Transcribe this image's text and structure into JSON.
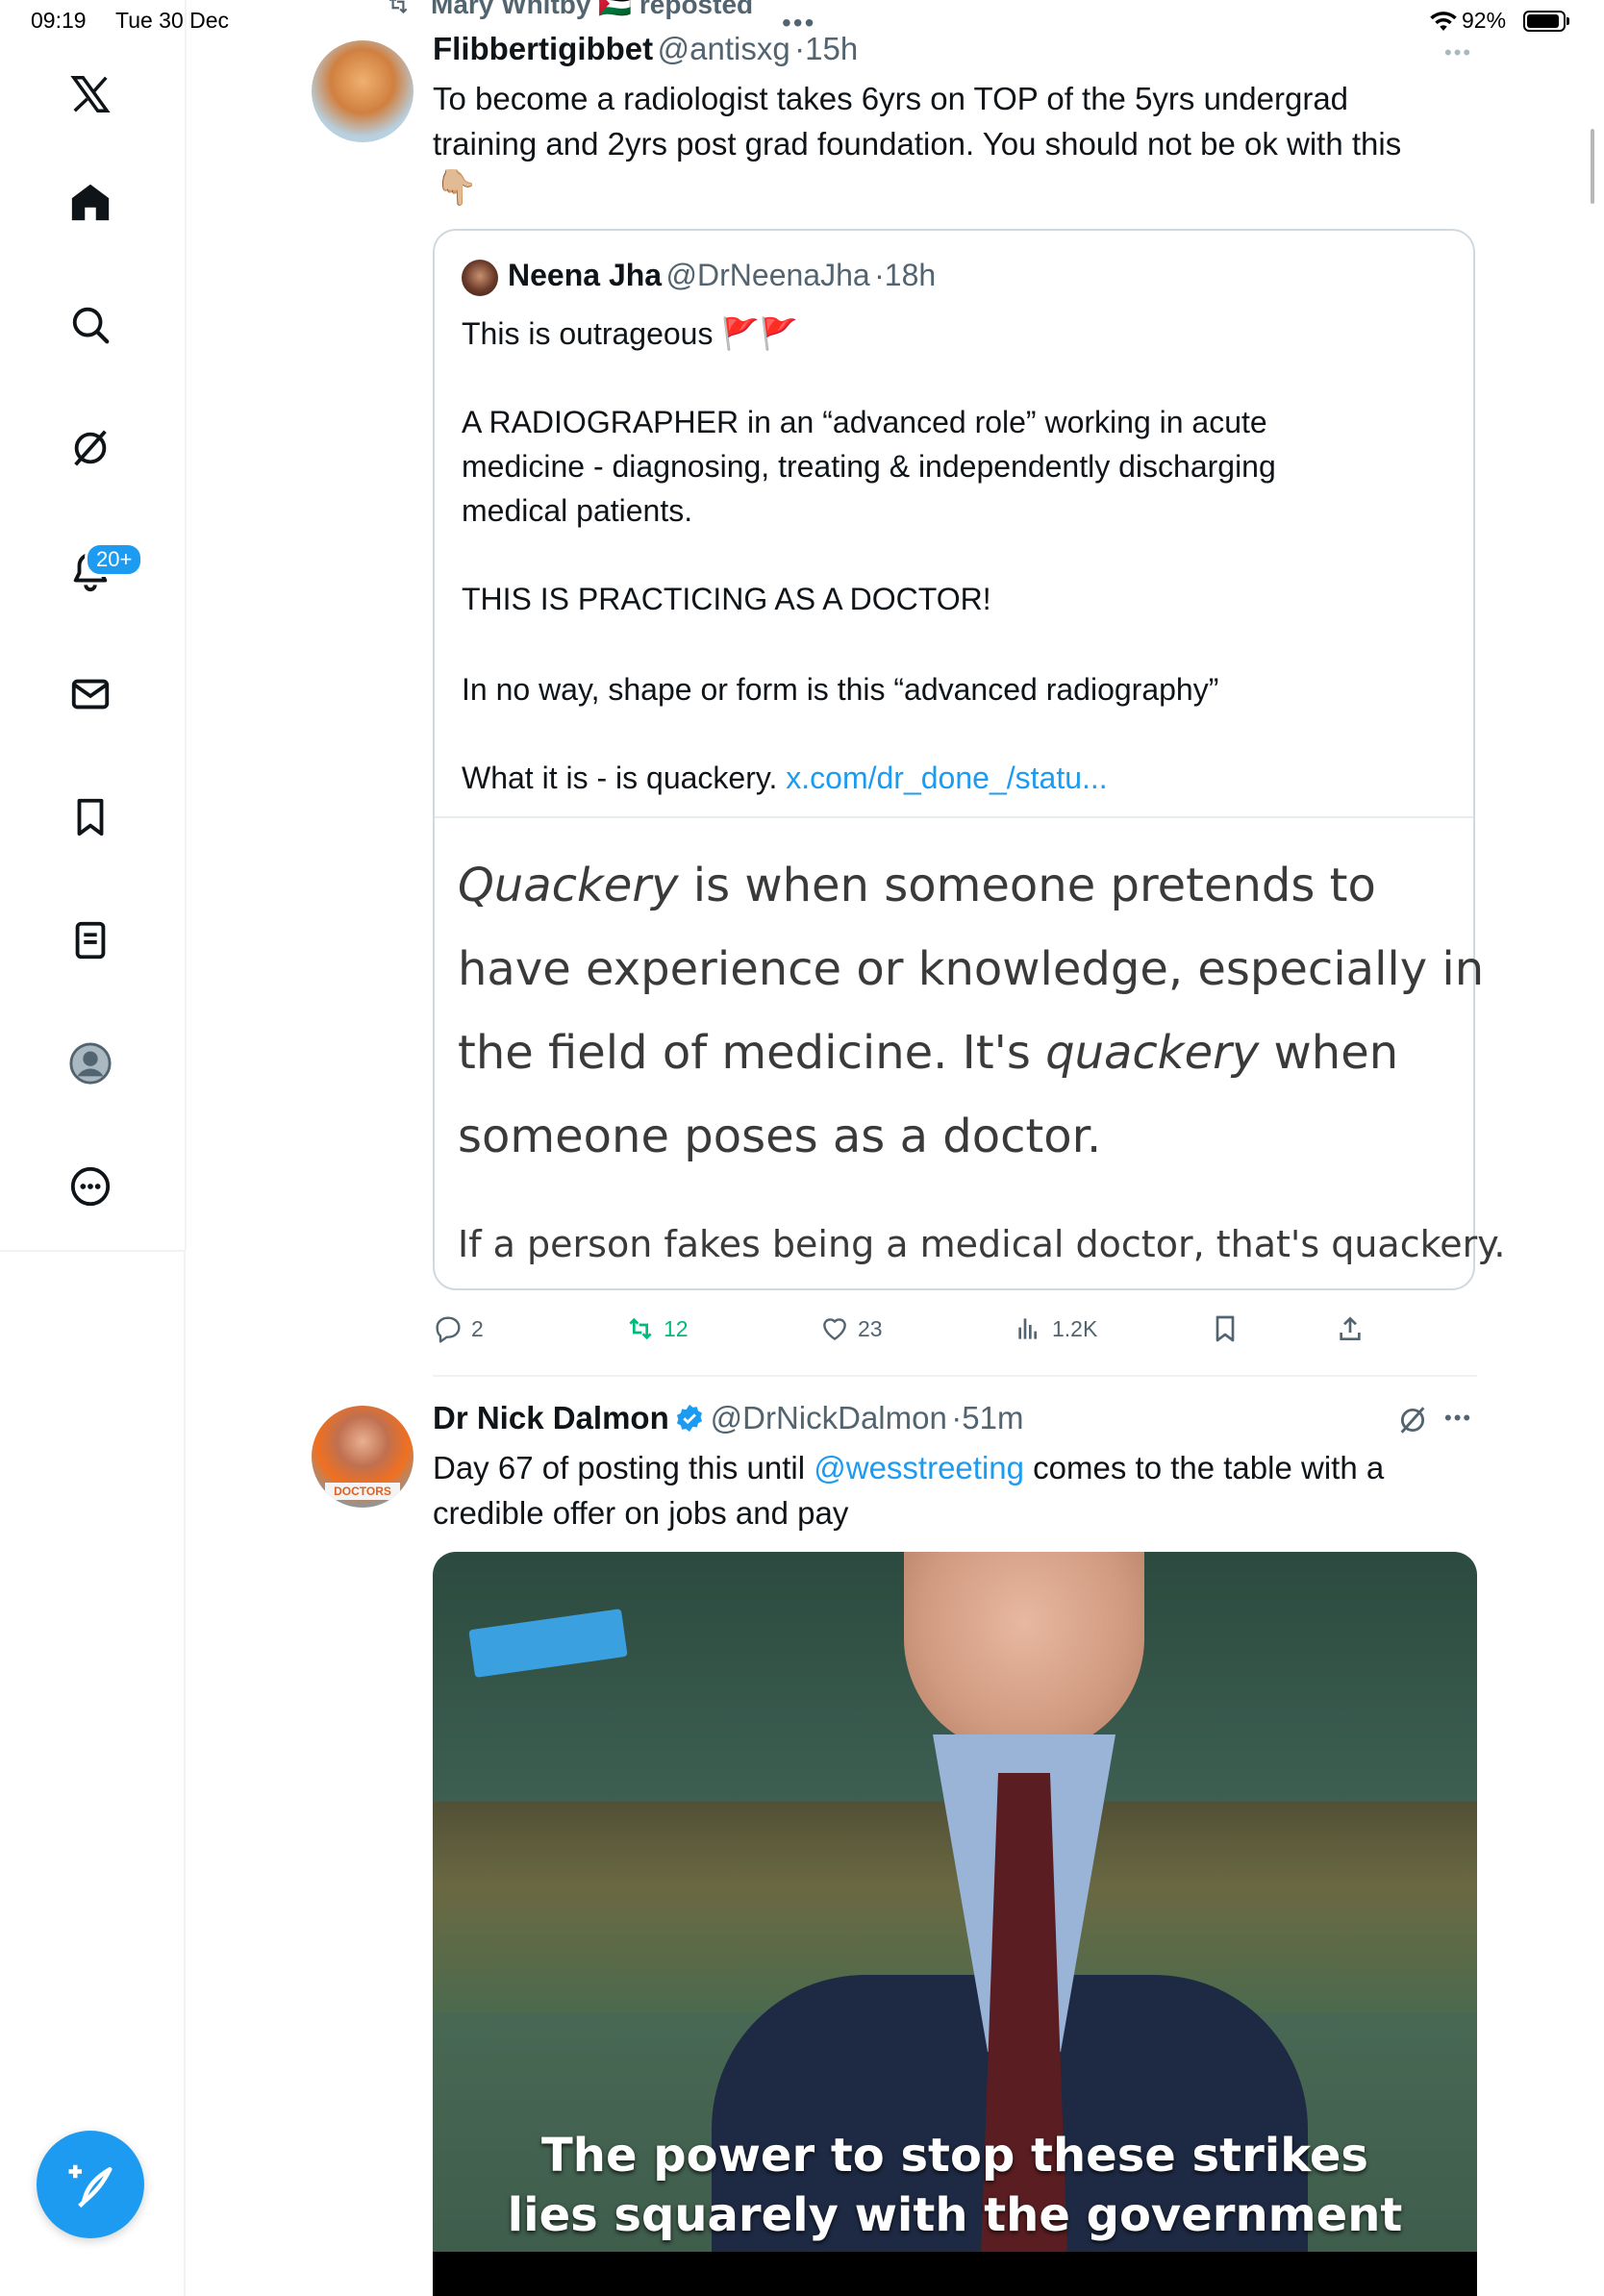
{
  "status_bar": {
    "time": "09:19",
    "date": "Tue 30 Dec",
    "battery": "92%"
  },
  "nav": {
    "icons": [
      "x-logo-icon",
      "home-icon",
      "search-icon",
      "grok-icon",
      "notifications-icon",
      "messages-icon",
      "bookmarks-icon",
      "lists-icon",
      "profile-icon",
      "more-icon"
    ],
    "notifications_badge": "20+"
  },
  "repost_banner": {
    "text": "Mary Whitby 🇵🇸 reposted"
  },
  "tweet1": {
    "name": "Flibbertigibbet",
    "handle": "@antisxg",
    "time": "15h",
    "line1": "To become a radiologist takes 6yrs on TOP of the 5yrs undergrad",
    "line2": "training and 2yrs post grad foundation. You should not be ok with this",
    "emoji": "👇🏼",
    "quote": {
      "name": "Neena Jha",
      "handle": "@DrNeenaJha",
      "time": "18h",
      "line1": "This is outrageous 🚩🚩",
      "para2_l1": "A RADIOGRAPHER in an “advanced role” working in acute",
      "para2_l2": "medicine - diagnosing, treating & independently discharging",
      "para2_l3": "medical patients.",
      "para3": "THIS IS PRACTICING AS A DOCTOR!",
      "para4": "In no way, shape or form is this “advanced radiography”",
      "para5_text": "What it is - is quackery.",
      "para5_link": "x.com/dr_done_/statu...",
      "image_text": {
        "l1_italic": "Quackery",
        "l1_rest": " is when someone pretends to",
        "l2": "have experience or knowledge, especially in",
        "l3_a": "the field of medicine. It's ",
        "l3_italic": "quackery",
        "l3_b": " when",
        "l4": "someone poses as a doctor.",
        "l5": "If a person fakes being a medical doctor, that's quackery."
      }
    },
    "actions": {
      "replies": "2",
      "reposts": "12",
      "likes": "23",
      "views": "1.2K"
    }
  },
  "tweet2": {
    "name": "Dr Nick Dalmon",
    "handle": "@DrNickDalmon",
    "time": "51m",
    "text_a": "Day 67 of posting this until ",
    "mention": "@wesstreeting",
    "text_b": " comes to the table with a",
    "line2": "credible offer on jobs and pay",
    "avatar_sign": "DOCTORS",
    "video_caption_1": "The power to stop these strikes",
    "video_caption_2": "lies squarely with the government"
  },
  "colors": {
    "accent": "#1d9bf0",
    "repost_green": "#00ba7c",
    "muted": "#536471",
    "border": "#cfd9de"
  }
}
